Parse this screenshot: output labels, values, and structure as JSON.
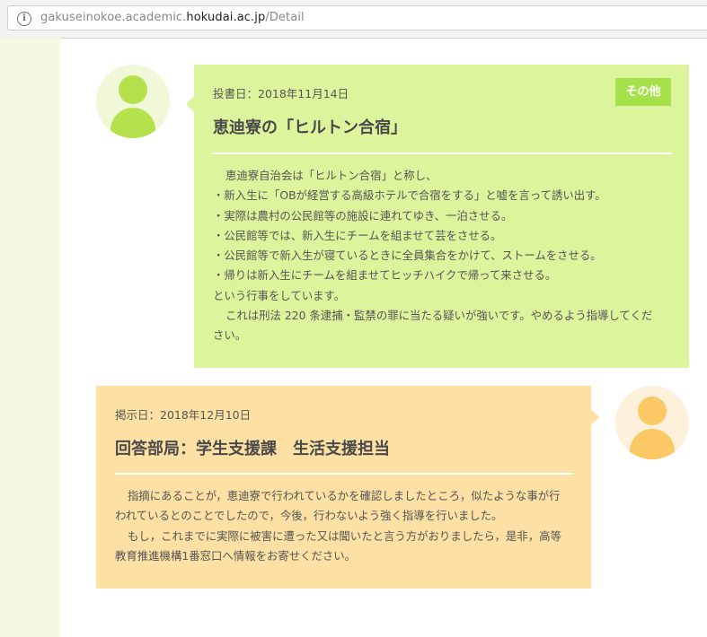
{
  "address_bar": {
    "url_prefix": "gakuseinokoe.academic.",
    "url_host": "hokudai.ac.jp",
    "url_path": "/Detail"
  },
  "question": {
    "date_label": "投書日：2018年11月14日",
    "category_tag": "その他",
    "title": "恵迪寮の「ヒルトン合宿」",
    "body_lines": [
      "恵迪寮自治会は「ヒルトン合宿」と称し、",
      "・新入生に「OBが経営する高級ホテルで合宿をする」と嘘を言って誘い出す。",
      "・実際は農村の公民館等の施設に連れてゆき、一泊させる。",
      "・公民館等では、新入生にチームを組ませて芸をさせる。",
      "・公民館等で新入生が寝ているときに全員集合をかけて、ストームをさせる。",
      "・帰りは新入生にチームを組ませてヒッチハイクで帰って来させる。",
      "という行事をしています。",
      "これは刑法 220 条逮捕・監禁の罪に当たる疑いが強いです。やめるよう指導してくだ",
      "さい。"
    ]
  },
  "answer": {
    "date_label": "掲示日：2018年12月10日",
    "title": "回答部局：学生支援課　生活支援担当",
    "body_lines": [
      "指摘にあることが，恵迪寮で行われているかを確認しましたところ，似たような事が行",
      "われているとのことでしたので，今後，行わないよう強く指導を行いました。",
      "もし，これまでに実際に被害に遭った又は聞いたと言う方がおりましたら，是非，高等",
      "教育推進機構1番窓口へ情報をお寄せください。"
    ]
  },
  "colors": {
    "question_bg": "#dcf49c",
    "question_avatar": "#b5e24c",
    "tag_bg": "#a6e04a",
    "answer_bg": "#fde0a3",
    "answer_avatar": "#fcc765",
    "sidebar_bg": "#f4f9e6"
  },
  "icons": {
    "address_info": "info-icon",
    "question_avatar": "user-avatar-icon",
    "answer_avatar": "user-avatar-icon"
  }
}
